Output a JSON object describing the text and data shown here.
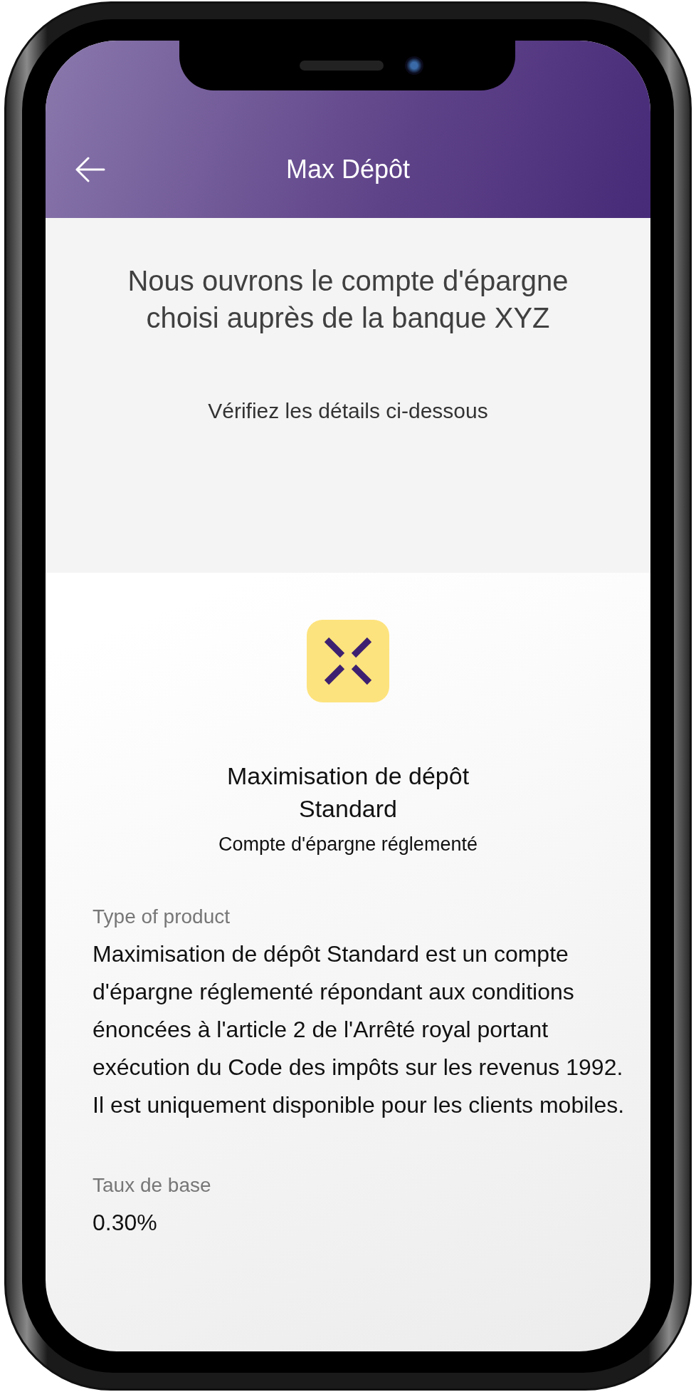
{
  "header": {
    "title": "Max Dépôt"
  },
  "intro": {
    "heading": "Nous ouvrons le compte d'épargne choisi auprès de la banque XYZ",
    "subheading": "Vérifiez les détails ci-dessous"
  },
  "product": {
    "name": "Maximisation de dépôt Standard",
    "category": "Compte d'épargne réglementé"
  },
  "details": [
    {
      "label": "Type of product",
      "value": "Maximisation de dépôt Standard est un compte d'épargne réglementé répondant aux conditions énoncées à l'article 2 de l'Arrêté royal portant exécution du Code des impôts sur les revenus 1992. Il est uniquement disponible pour les clients mobiles."
    },
    {
      "label": "Taux de base",
      "value": "0.30%"
    }
  ]
}
